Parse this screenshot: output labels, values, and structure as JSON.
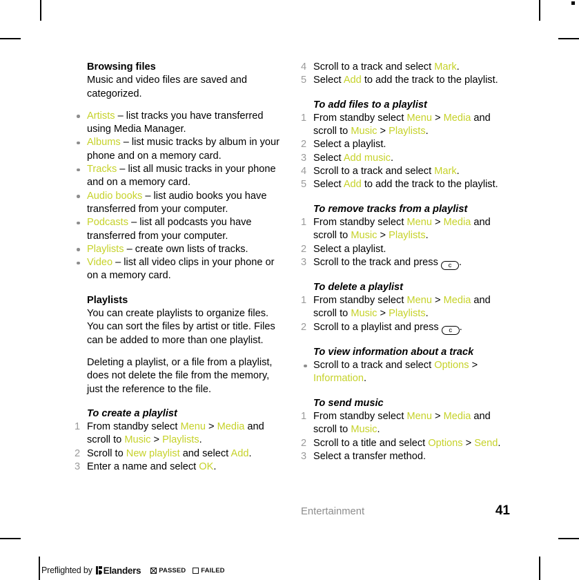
{
  "accent_color": "#c6d22a",
  "number_color": "#9a9a9a",
  "bullet_color": "#8d8d8d",
  "left_column": {
    "heading": "Browsing files",
    "intro": "Music and video files are saved and categorized.",
    "bullets": [
      {
        "term": "Artists",
        "rest": " – list tracks you have transferred using Media Manager."
      },
      {
        "term": "Albums",
        "rest": " – list music tracks by album in your phone and on a memory card."
      },
      {
        "term": "Tracks",
        "rest": " – list all music tracks in your phone and on a memory card."
      },
      {
        "term": "Audio books",
        "rest": " – list audio books you have transferred from your computer."
      },
      {
        "term": "Podcasts",
        "rest": " – list all podcasts you have transferred from your computer."
      },
      {
        "term": "Playlists",
        "rest": " – create own lists of tracks."
      },
      {
        "term": "Video",
        "rest": " – list all video clips in your phone or on a memory card."
      }
    ],
    "playlists_heading": "Playlists",
    "playlists_para1": "You can create playlists to organize files. You can sort the files by artist or title. Files can be added to more than one playlist.",
    "playlists_para2": "Deleting a playlist, or a file from a playlist, does not delete the file from the memory, just the reference to the file.",
    "procedure": {
      "title": "To create a playlist",
      "steps": [
        {
          "n": "1",
          "parts": [
            {
              "t": "From standby select ",
              "s": "plain"
            },
            {
              "t": "Menu",
              "s": "accent"
            },
            {
              "t": " > ",
              "s": "plain"
            },
            {
              "t": "Media",
              "s": "accent"
            },
            {
              "t": " and scroll to ",
              "s": "plain"
            },
            {
              "t": "Music",
              "s": "accent"
            },
            {
              "t": " > ",
              "s": "plain"
            },
            {
              "t": "Playlists",
              "s": "accent"
            },
            {
              "t": ".",
              "s": "plain"
            }
          ]
        },
        {
          "n": "2",
          "parts": [
            {
              "t": "Scroll to ",
              "s": "plain"
            },
            {
              "t": "New playlist",
              "s": "accent"
            },
            {
              "t": " and select ",
              "s": "plain"
            },
            {
              "t": "Add",
              "s": "accent"
            },
            {
              "t": ".",
              "s": "plain"
            }
          ]
        },
        {
          "n": "3",
          "parts": [
            {
              "t": "Enter a name and select ",
              "s": "plain"
            },
            {
              "t": "OK",
              "s": "accent"
            },
            {
              "t": ".",
              "s": "plain"
            }
          ]
        }
      ]
    }
  },
  "right_column": {
    "continued_steps": [
      {
        "n": "4",
        "parts": [
          {
            "t": "Scroll to a track and select ",
            "s": "plain"
          },
          {
            "t": "Mark",
            "s": "accent"
          },
          {
            "t": ".",
            "s": "plain"
          }
        ]
      },
      {
        "n": "5",
        "parts": [
          {
            "t": "Select ",
            "s": "plain"
          },
          {
            "t": "Add",
            "s": "accent"
          },
          {
            "t": " to add the track to the playlist.",
            "s": "plain"
          }
        ]
      }
    ],
    "procedures": [
      {
        "title": "To add files to a playlist",
        "steps": [
          {
            "n": "1",
            "parts": [
              {
                "t": "From standby select ",
                "s": "plain"
              },
              {
                "t": "Menu",
                "s": "accent"
              },
              {
                "t": " > ",
                "s": "plain"
              },
              {
                "t": "Media",
                "s": "accent"
              },
              {
                "t": " and scroll to ",
                "s": "plain"
              },
              {
                "t": "Music",
                "s": "accent"
              },
              {
                "t": " > ",
                "s": "plain"
              },
              {
                "t": "Playlists",
                "s": "accent"
              },
              {
                "t": ".",
                "s": "plain"
              }
            ]
          },
          {
            "n": "2",
            "parts": [
              {
                "t": "Select a playlist.",
                "s": "plain"
              }
            ]
          },
          {
            "n": "3",
            "parts": [
              {
                "t": "Select ",
                "s": "plain"
              },
              {
                "t": "Add music",
                "s": "accent"
              },
              {
                "t": ".",
                "s": "plain"
              }
            ]
          },
          {
            "n": "4",
            "parts": [
              {
                "t": "Scroll to a track and select ",
                "s": "plain"
              },
              {
                "t": "Mark",
                "s": "accent"
              },
              {
                "t": ".",
                "s": "plain"
              }
            ]
          },
          {
            "n": "5",
            "parts": [
              {
                "t": "Select ",
                "s": "plain"
              },
              {
                "t": "Add",
                "s": "accent"
              },
              {
                "t": " to add the track to the playlist.",
                "s": "plain"
              }
            ]
          }
        ]
      },
      {
        "title": "To remove tracks from a playlist",
        "steps": [
          {
            "n": "1",
            "parts": [
              {
                "t": "From standby select ",
                "s": "plain"
              },
              {
                "t": "Menu",
                "s": "accent"
              },
              {
                "t": " > ",
                "s": "plain"
              },
              {
                "t": "Media",
                "s": "accent"
              },
              {
                "t": " and scroll to ",
                "s": "plain"
              },
              {
                "t": "Music",
                "s": "accent"
              },
              {
                "t": " > ",
                "s": "plain"
              },
              {
                "t": "Playlists",
                "s": "accent"
              },
              {
                "t": ".",
                "s": "plain"
              }
            ]
          },
          {
            "n": "2",
            "parts": [
              {
                "t": "Select a playlist.",
                "s": "plain"
              }
            ]
          },
          {
            "n": "3",
            "parts": [
              {
                "t": "Scroll to the track and press ",
                "s": "plain"
              },
              {
                "t": "c",
                "s": "key"
              },
              {
                "t": ".",
                "s": "plain"
              }
            ]
          }
        ]
      },
      {
        "title": "To delete a playlist",
        "steps": [
          {
            "n": "1",
            "parts": [
              {
                "t": "From standby select ",
                "s": "plain"
              },
              {
                "t": "Menu",
                "s": "accent"
              },
              {
                "t": " > ",
                "s": "plain"
              },
              {
                "t": "Media",
                "s": "accent"
              },
              {
                "t": " and scroll to ",
                "s": "plain"
              },
              {
                "t": "Music",
                "s": "accent"
              },
              {
                "t": " > ",
                "s": "plain"
              },
              {
                "t": "Playlists",
                "s": "accent"
              },
              {
                "t": ".",
                "s": "plain"
              }
            ]
          },
          {
            "n": "2",
            "parts": [
              {
                "t": "Scroll to a playlist and press ",
                "s": "plain"
              },
              {
                "t": "c",
                "s": "key"
              },
              {
                "t": ".",
                "s": "plain"
              }
            ]
          }
        ]
      },
      {
        "title": "To view information about a track",
        "bulleted": true,
        "steps": [
          {
            "n": "",
            "parts": [
              {
                "t": "Scroll to a track and select ",
                "s": "plain"
              },
              {
                "t": "Options",
                "s": "accent"
              },
              {
                "t": " > ",
                "s": "plain"
              },
              {
                "t": "Information",
                "s": "accent"
              },
              {
                "t": ".",
                "s": "plain"
              }
            ]
          }
        ]
      },
      {
        "title": "To send music",
        "steps": [
          {
            "n": "1",
            "parts": [
              {
                "t": "From standby select ",
                "s": "plain"
              },
              {
                "t": "Menu",
                "s": "accent"
              },
              {
                "t": " > ",
                "s": "plain"
              },
              {
                "t": "Media",
                "s": "accent"
              },
              {
                "t": " and scroll to ",
                "s": "plain"
              },
              {
                "t": "Music",
                "s": "accent"
              },
              {
                "t": ".",
                "s": "plain"
              }
            ]
          },
          {
            "n": "2",
            "parts": [
              {
                "t": "Scroll to a title and select ",
                "s": "plain"
              },
              {
                "t": "Options",
                "s": "accent"
              },
              {
                "t": " > ",
                "s": "plain"
              },
              {
                "t": "Send",
                "s": "accent"
              },
              {
                "t": ".",
                "s": "plain"
              }
            ]
          },
          {
            "n": "3",
            "parts": [
              {
                "t": "Select a transfer method.",
                "s": "plain"
              }
            ]
          }
        ]
      }
    ]
  },
  "footer": {
    "chapter": "Entertainment",
    "page_number": "41"
  },
  "preflight": {
    "label": "Preflighted by",
    "brand": "Elanders",
    "passed_label": "PASSED",
    "failed_label": "FAILED",
    "passed_checked": true,
    "failed_checked": false
  }
}
